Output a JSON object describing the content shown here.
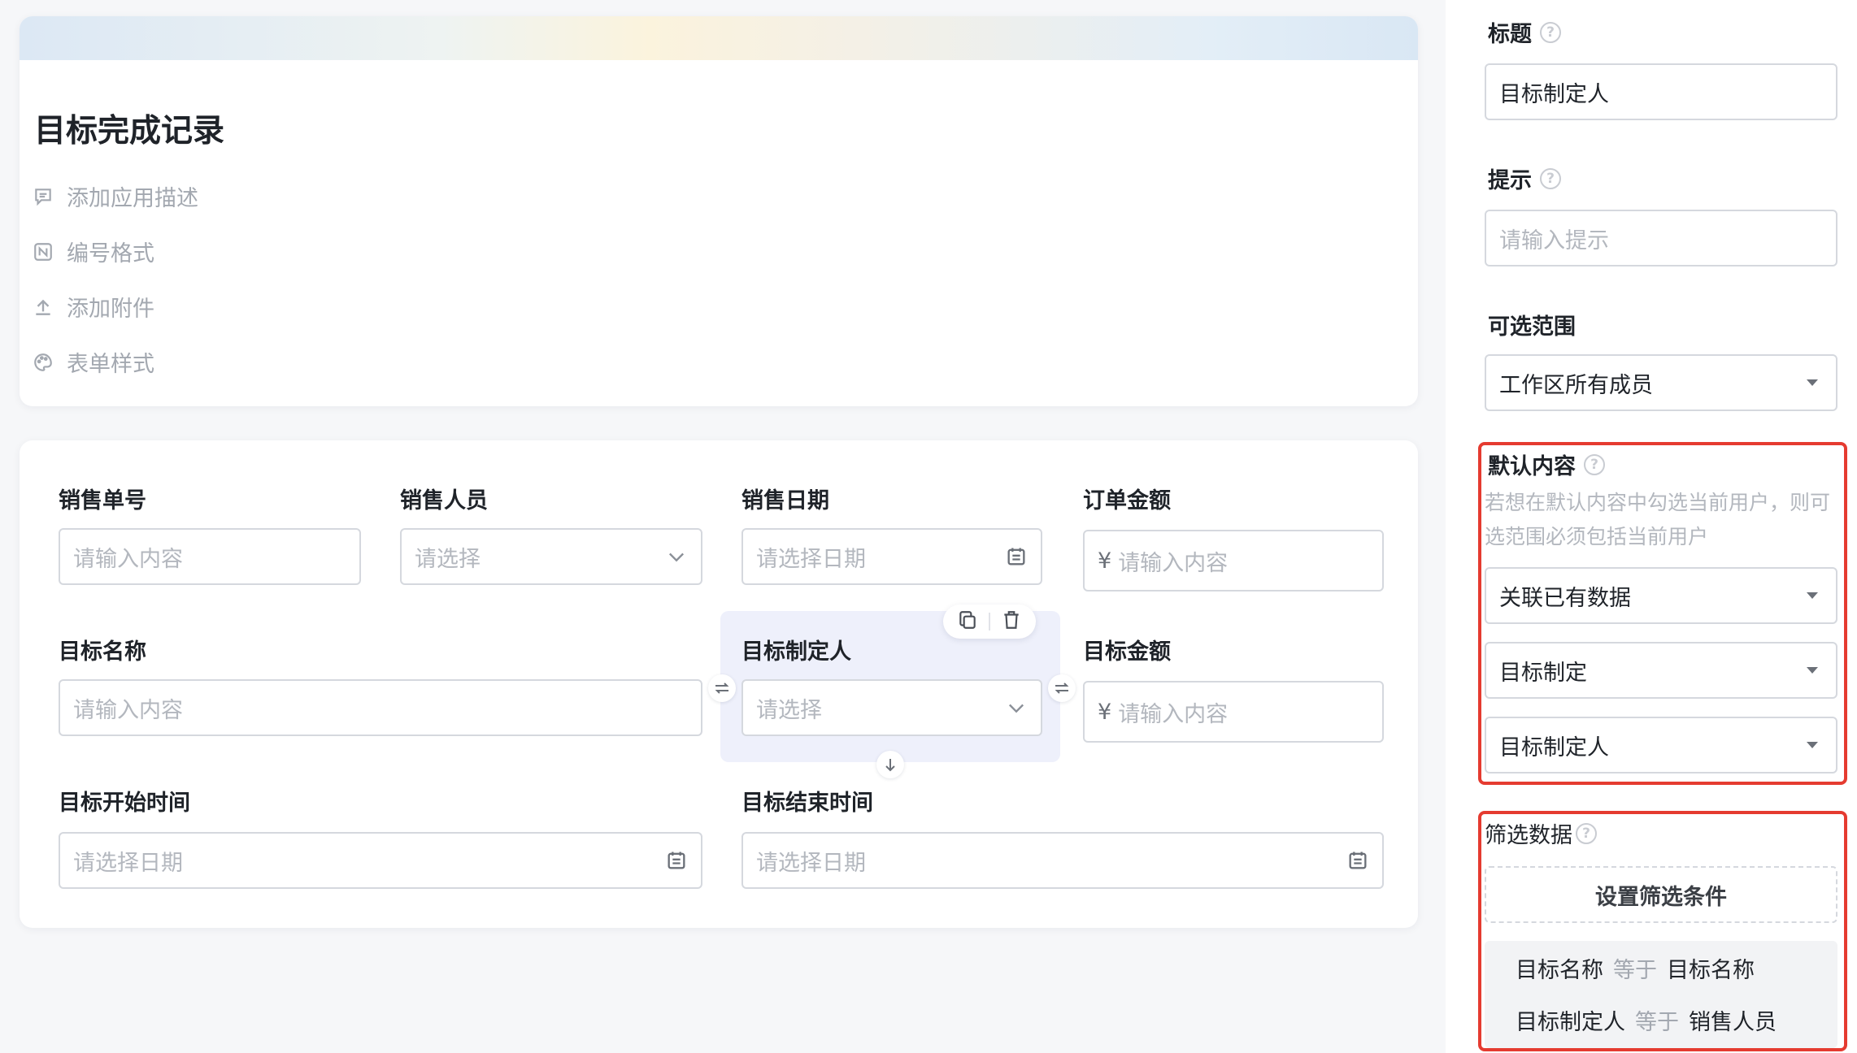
{
  "app": {
    "title": "目标完成记录",
    "meta": [
      {
        "label": "添加应用描述",
        "icon": "comment-icon"
      },
      {
        "label": "编号格式",
        "icon": "numbering-icon"
      },
      {
        "label": "添加附件",
        "icon": "upload-icon"
      },
      {
        "label": "表单样式",
        "icon": "palette-icon"
      }
    ]
  },
  "form": {
    "fields": [
      {
        "label": "销售单号",
        "placeholder": "请输入内容",
        "type": "text"
      },
      {
        "label": "销售人员",
        "placeholder": "请选择",
        "type": "select"
      },
      {
        "label": "销售日期",
        "placeholder": "请选择日期",
        "type": "date"
      },
      {
        "label": "订单金额",
        "placeholder": "请输入内容",
        "type": "currency",
        "prefix": "¥"
      },
      {
        "label": "目标名称",
        "placeholder": "请输入内容",
        "type": "text"
      },
      {
        "label": "目标制定人",
        "placeholder": "请选择",
        "type": "select",
        "selected": true
      },
      {
        "label": "目标金额",
        "placeholder": "请输入内容",
        "type": "currency",
        "prefix": "¥"
      },
      {
        "label": "目标开始时间",
        "placeholder": "请选择日期",
        "type": "date"
      },
      {
        "label": "目标结束时间",
        "placeholder": "请选择日期",
        "type": "date"
      }
    ]
  },
  "panel": {
    "title_label": "标题",
    "title_value": "目标制定人",
    "hint_label": "提示",
    "hint_placeholder": "请输入提示",
    "range_label": "可选范围",
    "range_value": "工作区所有成员",
    "default_label": "默认内容",
    "default_hint": "若想在默认内容中勾选当前用户，则可选范围必须包括当前用户",
    "default_source": "关联已有数据",
    "default_form": "目标制定",
    "default_field": "目标制定人",
    "filter_label": "筛选数据",
    "filter_button": "设置筛选条件",
    "conditions": [
      {
        "field": "目标名称",
        "op": "等于",
        "value": "目标名称"
      },
      {
        "field": "目标制定人",
        "op": "等于",
        "value": "销售人员"
      }
    ]
  },
  "colors": {
    "highlight_border": "#e53b30",
    "selected_field_bg": "#eef0fb",
    "placeholder": "#b3b7be"
  }
}
